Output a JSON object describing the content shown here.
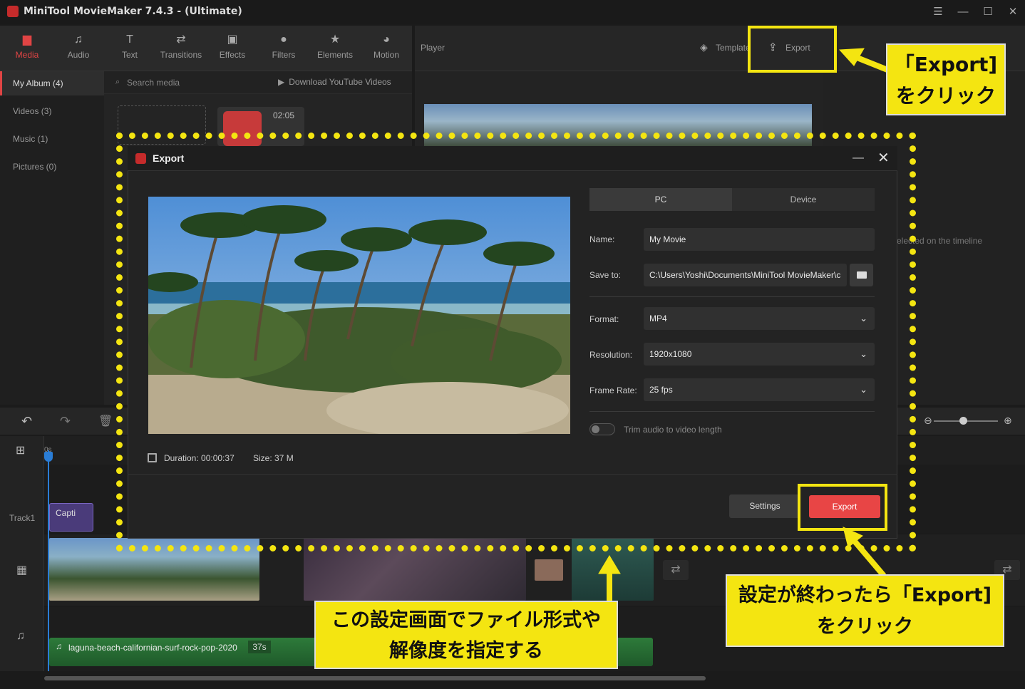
{
  "window": {
    "title": "MiniTool MovieMaker 7.4.3 - (Ultimate)"
  },
  "tabs": [
    {
      "label": "Media",
      "icon": "folder-icon"
    },
    {
      "label": "Audio",
      "icon": "music-note-icon"
    },
    {
      "label": "Text",
      "icon": "text-icon"
    },
    {
      "label": "Transitions",
      "icon": "transition-icon"
    },
    {
      "label": "Effects",
      "icon": "effects-icon"
    },
    {
      "label": "Filters",
      "icon": "filters-icon"
    },
    {
      "label": "Elements",
      "icon": "elements-icon"
    },
    {
      "label": "Motion",
      "icon": "motion-icon"
    }
  ],
  "sidebar": [
    {
      "label": "My Album (4)"
    },
    {
      "label": "Videos (3)"
    },
    {
      "label": "Music (1)"
    },
    {
      "label": "Pictures (0)"
    }
  ],
  "search": {
    "placeholder": "Search media",
    "youtube": "Download YouTube Videos"
  },
  "media": {
    "duration": "02:05"
  },
  "player": {
    "label": "Player",
    "template": "Template",
    "export": "Export",
    "hint": "elected on the timeline"
  },
  "timeline": {
    "track1": "Track1",
    "caption": "Capti",
    "audio_name": "laguna-beach-californian-surf-rock-pop-2020",
    "audio_dur": "37s",
    "ruler": "0s"
  },
  "dialog": {
    "title": "Export",
    "tab_pc": "PC",
    "tab_device": "Device",
    "name_label": "Name:",
    "name_value": "My Movie",
    "save_label": "Save to:",
    "save_value": "C:\\Users\\Yoshi\\Documents\\MiniTool MovieMaker\\c",
    "format_label": "Format:",
    "format_value": "MP4",
    "res_label": "Resolution:",
    "res_value": "1920x1080",
    "fps_label": "Frame Rate:",
    "fps_value": "25 fps",
    "trim_label": "Trim audio to video length",
    "duration": "Duration:  00:00:37",
    "size": "Size:  37 M",
    "settings_btn": "Settings",
    "export_btn": "Export"
  },
  "annotations": {
    "top_line1": "「Export]",
    "top_line2": "をクリック",
    "bottom_line1": "設定が終わったら「Export]",
    "bottom_line2": "をクリック",
    "center_line1": "この設定画面でファイル形式や",
    "center_line2": "解像度を指定する"
  },
  "colors": {
    "accent": "#e84545",
    "annotation": "#f4e511",
    "playhead": "#2a7dd6"
  }
}
